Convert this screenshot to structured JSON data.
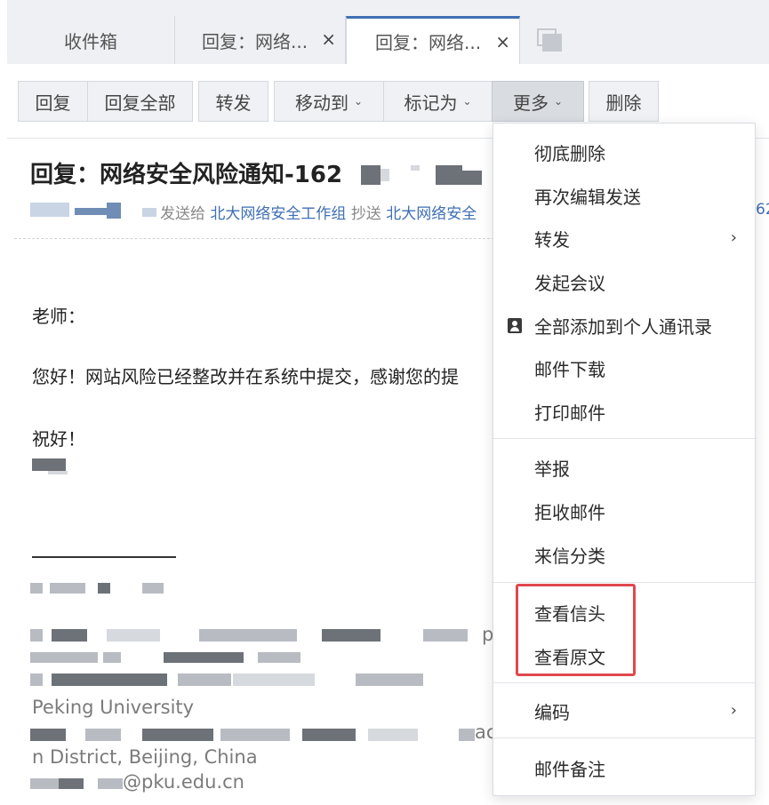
{
  "tabs": {
    "inbox": "收件箱",
    "reply1": "回复：网络...",
    "reply2": "回复：网络...",
    "close": "×"
  },
  "toolbar": {
    "reply": "回复",
    "reply_all": "回复全部",
    "forward": "转发",
    "move_to": "移动到",
    "mark_as": "标记为",
    "more": "更多",
    "delete": "删除",
    "chevron": "⌄"
  },
  "mail": {
    "subject": "回复：网络安全风险通知-162",
    "sent_to_label": "发送给",
    "recipient": "北大网络安全工作组",
    "cc_label": "抄送",
    "cc_recipient": "北大网络安全",
    "trailing_digits": "62"
  },
  "body": {
    "greeting": "老师：",
    "line1": "您好！网站风险已经整改并在系统中提交，感谢您的提",
    "closing": "祝好！"
  },
  "signature": {
    "university": "Peking University",
    "district": "n District, Beijing, China",
    "email_fragment": "@pku.edu.cn",
    "partial_p": "p",
    "partial_ac": "ac"
  },
  "more_menu": {
    "items": [
      "彻底删除",
      "再次编辑发送",
      "转发",
      "发起会议",
      "全部添加到个人通讯录",
      "邮件下载",
      "打印邮件",
      "举报",
      "拒收邮件",
      "来信分类",
      "查看信头",
      "查看原文",
      "编码",
      "邮件备注"
    ],
    "submenu_arrow": "›"
  },
  "colors": {
    "accent": "#3f6fb5",
    "highlight_box": "#e0484e"
  }
}
